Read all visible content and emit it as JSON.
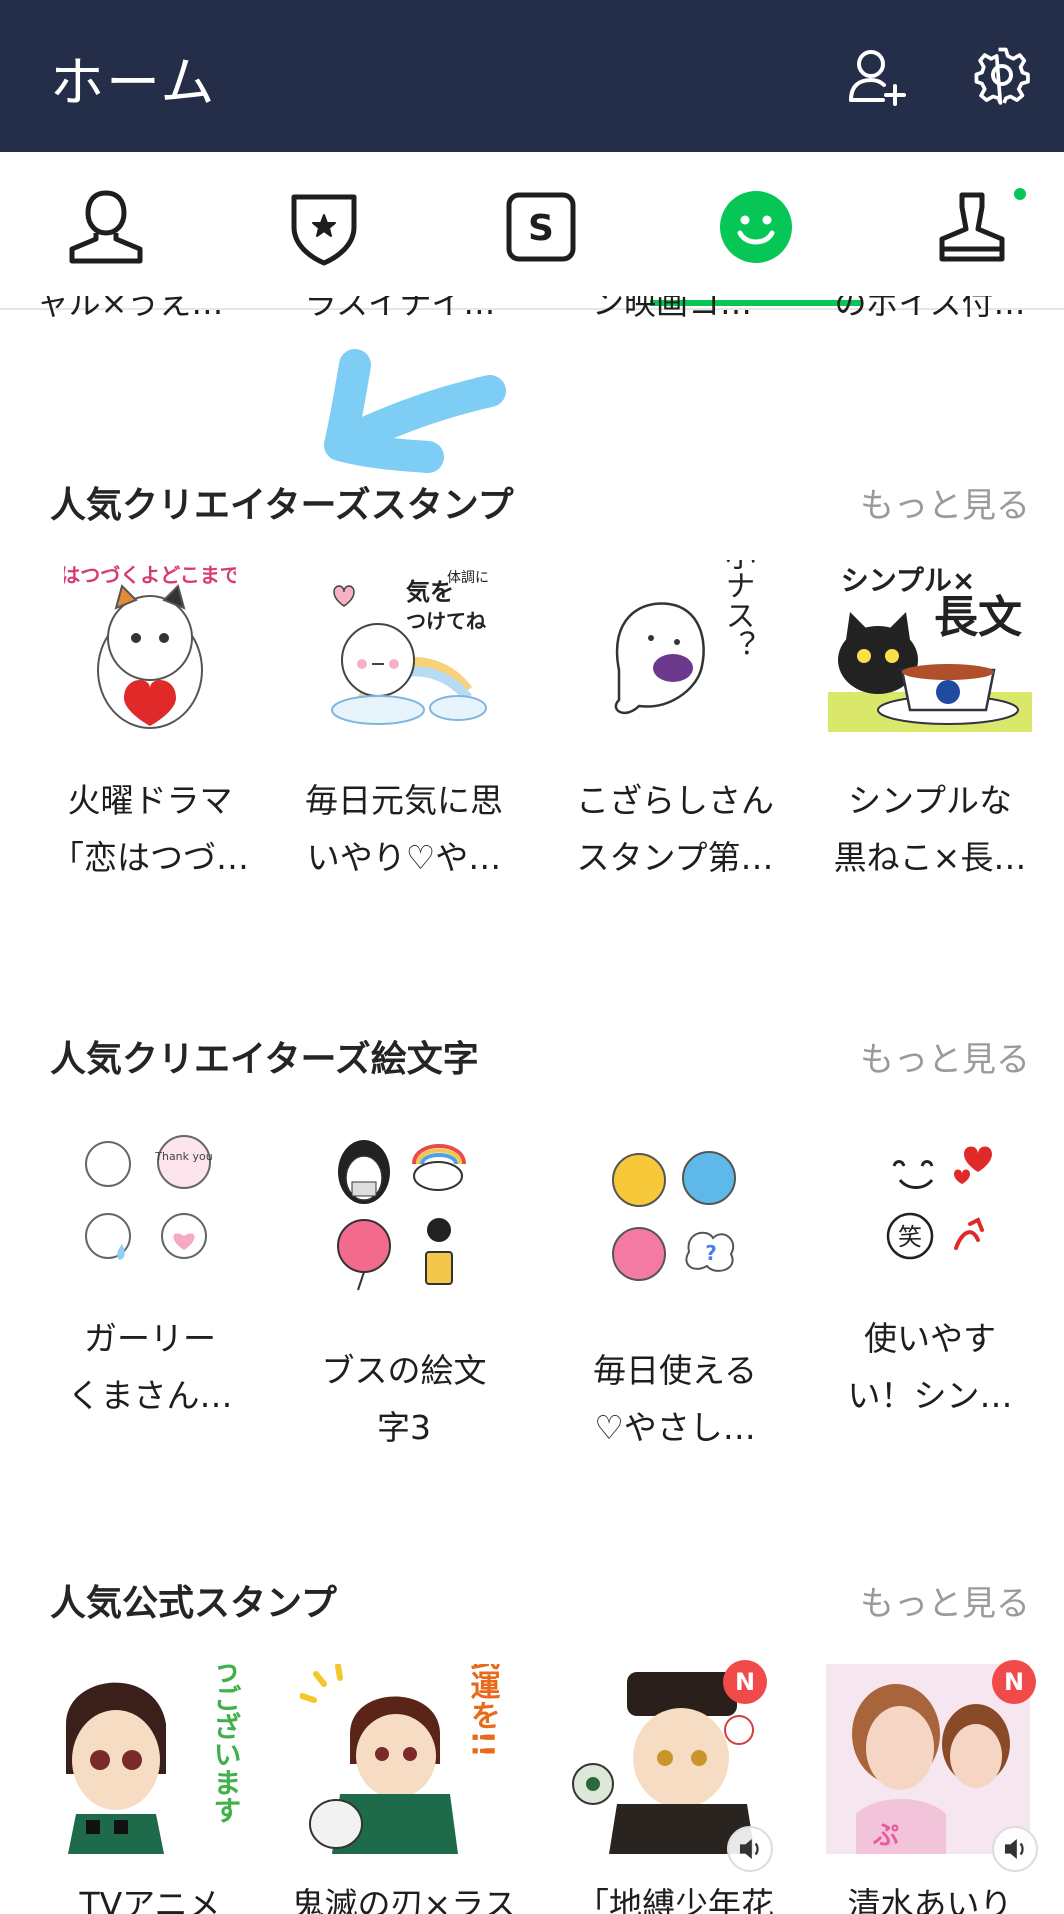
{
  "header": {
    "title": "ホーム",
    "add_friend_icon": "add-friend-icon",
    "settings_icon": "gear-icon",
    "bg": "#252e48"
  },
  "tabs": [
    {
      "name": "tab-friends",
      "icon": "person-icon"
    },
    {
      "name": "tab-premium",
      "icon": "shield-star-icon"
    },
    {
      "name": "tab-stickers-s",
      "icon": "s-square-icon"
    },
    {
      "name": "tab-stickers",
      "icon": "smiley-icon",
      "active": true
    },
    {
      "name": "tab-creators",
      "icon": "stamp-icon",
      "has_dot": true
    }
  ],
  "accent": "#06c755",
  "cut_off_row": [
    "ャル×うえ…",
    "ラスイナイ…",
    "ン映画コ…",
    "のボイス付…"
  ],
  "sections": [
    {
      "title": "人気クリエイターズスタンプ",
      "more": "もっと見る",
      "items": [
        {
          "name_line1": "火曜ドラマ",
          "name_line2": "「恋はつづ…"
        },
        {
          "name_line1": "毎日元気に思",
          "name_line2": "いやり♡や…"
        },
        {
          "name_line1": "こざらしさん",
          "name_line2": "スタンプ第…"
        },
        {
          "name_line1": "シンプルな",
          "name_line2": "黒ねこ×長…"
        }
      ]
    },
    {
      "title": "人気クリエイターズ絵文字",
      "more": "もっと見る",
      "items": [
        {
          "name_line1": "ガーリー",
          "name_line2": "くまさん…"
        },
        {
          "name_line1": "ブスの絵文",
          "name_line2": "字3"
        },
        {
          "name_line1": "毎日使える",
          "name_line2": "♡やさし…"
        },
        {
          "name_line1": "使いやす",
          "name_line2": "い！シン…"
        }
      ]
    },
    {
      "title": "人気公式スタンプ",
      "more": "もっと見る",
      "items": [
        {
          "name_line1": "TVアニメ",
          "new_badge": ""
        },
        {
          "name_line1": "鬼滅の刃×ラス",
          "new_badge": ""
        },
        {
          "name_line1": "「地縛少年花",
          "new_badge": "N",
          "sound": true
        },
        {
          "name_line1": "清水あいり",
          "new_badge": "N",
          "sound": true
        }
      ]
    }
  ],
  "thumb_art": {
    "s1_0": {
      "text": "恋はつづくよどこまでも"
    },
    "s1_1": {
      "text": "気を",
      "text2": "つけてね",
      "text3": "体調に"
    },
    "s1_2": {
      "text": "小ナス？"
    },
    "s1_3": {
      "text": "シンプル×",
      "text2": "長文"
    },
    "s2_0": {
      "text": "Thank you"
    },
    "s2_3": {
      "text": "笑"
    },
    "s3_0": {
      "text": "ありがとうございます"
    },
    "s3_1": {
      "text": "ご武運を!!"
    }
  }
}
